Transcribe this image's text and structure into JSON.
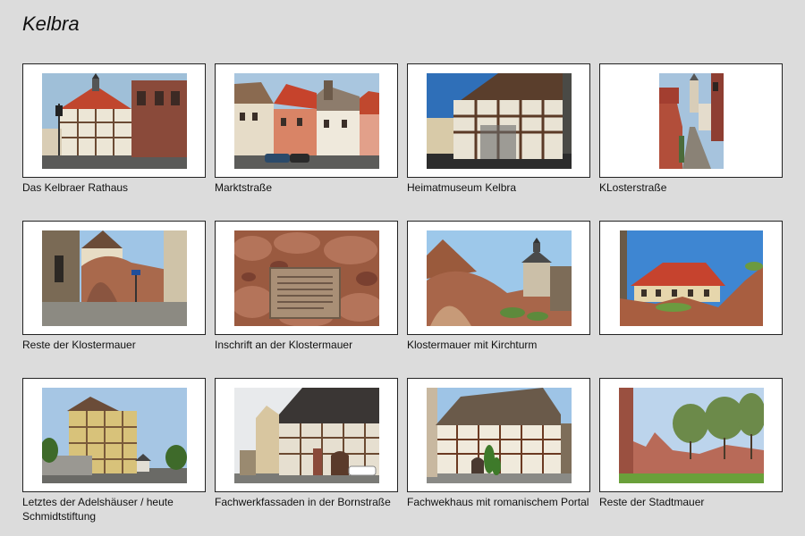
{
  "page": {
    "title": "Kelbra",
    "background": "#dcdcdc"
  },
  "gallery": {
    "items": [
      {
        "caption": "Das Kelbraer Rathaus",
        "thumb": "rathaus"
      },
      {
        "caption": "Marktstraße",
        "thumb": "markt"
      },
      {
        "caption": "Heimatmuseum Kelbra",
        "thumb": "museum"
      },
      {
        "caption": "KLosterstraße",
        "thumb": "kloster-strasse"
      },
      {
        "caption": "Reste der Klostermauer",
        "thumb": "mauer-reste"
      },
      {
        "caption": "Inschrift an der Klostermauer",
        "thumb": "inschrift"
      },
      {
        "caption": "Klostermauer mit Kirchturm",
        "thumb": "kirchturm"
      },
      {
        "caption": "",
        "thumb": "rotes-dach"
      },
      {
        "caption": "Letztes der Adelshäuser / heute Schmidtstiftung",
        "thumb": "adelshaus"
      },
      {
        "caption": "Fachwerkfassaden in der Bornstraße",
        "thumb": "bornstrasse"
      },
      {
        "caption": "Fachwekhaus mit romanischem Portal",
        "thumb": "portal"
      },
      {
        "caption": "Reste der Stadtmauer",
        "thumb": "stadtmauer"
      }
    ]
  }
}
